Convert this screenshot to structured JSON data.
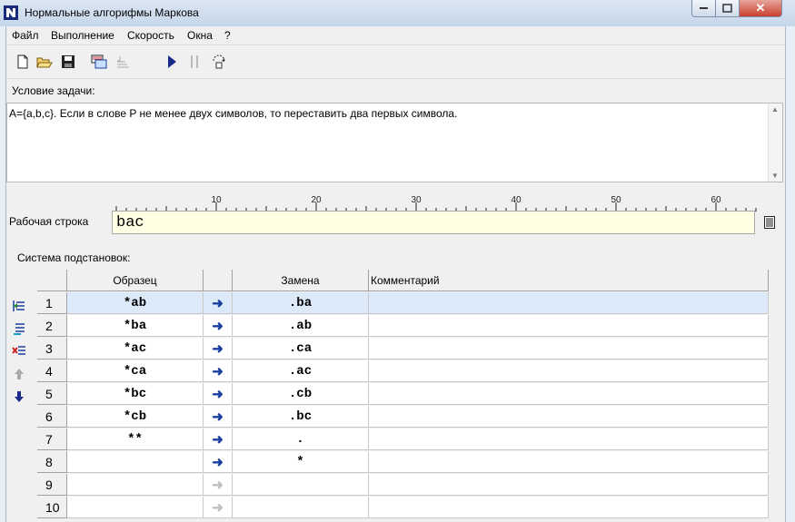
{
  "window": {
    "title": "Нормальные алгорифмы Маркова"
  },
  "menu": [
    "Файл",
    "Выполнение",
    "Скорость",
    "Окна",
    "?"
  ],
  "toolbar": {
    "icons": [
      "new-file-icon",
      "open-folder-icon",
      "save-icon",
      "load-icon",
      "export-icon",
      "run-icon",
      "pause-icon",
      "step-icon"
    ]
  },
  "condition": {
    "label": "Условие задачи:",
    "text": "A={a,b,c}. Если в слове P не менее двух символов, то переставить два первых символа."
  },
  "ruler": {
    "ticks": [
      "10",
      "20",
      "30",
      "40",
      "50",
      "60"
    ]
  },
  "working_string": {
    "label": "Рабочая строка",
    "value": "bac"
  },
  "substitutions": {
    "label": "Система подстановок:",
    "columns": [
      "Образец",
      "Замена",
      "Комментарий"
    ],
    "rows": [
      {
        "num": "1",
        "pattern": "*ab",
        "replacement": ".ba",
        "arrow": "active"
      },
      {
        "num": "2",
        "pattern": "*ba",
        "replacement": ".ab",
        "arrow": "active"
      },
      {
        "num": "3",
        "pattern": "*ac",
        "replacement": ".ca",
        "arrow": "active"
      },
      {
        "num": "4",
        "pattern": "*ca",
        "replacement": ".ac",
        "arrow": "active"
      },
      {
        "num": "5",
        "pattern": "*bc",
        "replacement": ".cb",
        "arrow": "active"
      },
      {
        "num": "6",
        "pattern": "*cb",
        "replacement": ".bc",
        "arrow": "active"
      },
      {
        "num": "7",
        "pattern": "**",
        "replacement": ".",
        "arrow": "active"
      },
      {
        "num": "8",
        "pattern": "",
        "replacement": "*",
        "arrow": "active"
      },
      {
        "num": "9",
        "pattern": "",
        "replacement": "",
        "arrow": "inactive"
      },
      {
        "num": "10",
        "pattern": "",
        "replacement": "",
        "arrow": "inactive"
      }
    ]
  },
  "colors": {
    "accent": "#1a3ea0",
    "selection": "#dbe9f9",
    "input_bg": "#ffffe4"
  }
}
